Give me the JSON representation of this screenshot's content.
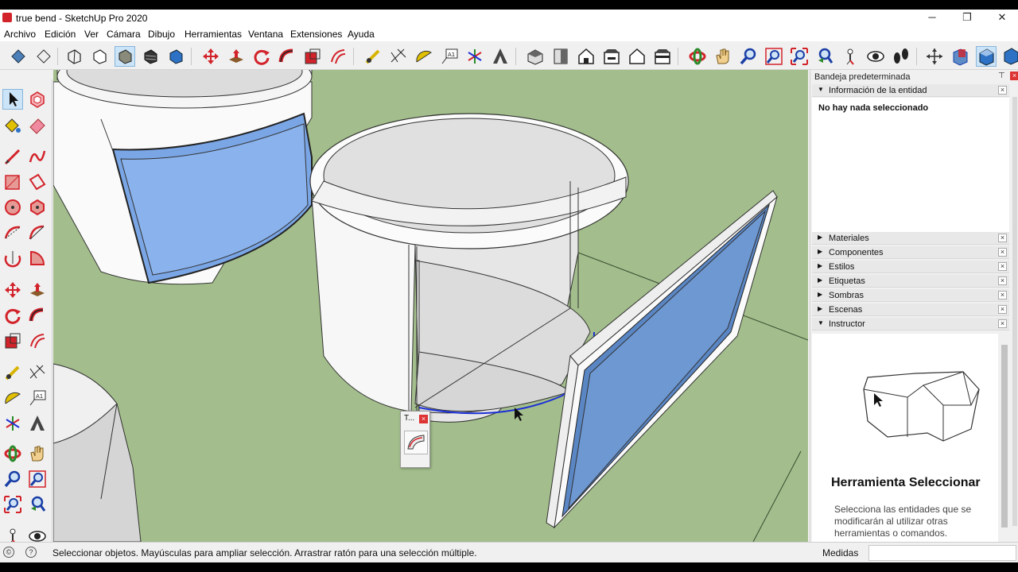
{
  "window": {
    "title": "true bend - SketchUp Pro 2020",
    "minimize": "─",
    "restore": "❐",
    "close": "✕"
  },
  "menu": [
    "Archivo",
    "Edición",
    "Ver",
    "Cámara",
    "Dibujo",
    "Herramientas",
    "Ventana",
    "Extensiones",
    "Ayuda"
  ],
  "toolbar": {
    "icons": [
      "xray-icon",
      "back-edges-icon",
      "wireframe-icon",
      "hidden-line-icon",
      "shaded-icon",
      "shaded-textures-icon",
      "monochrome-icon",
      "move-icon",
      "push-pull-icon",
      "rotate-icon",
      "follow-me-icon",
      "scale-icon",
      "offset-icon",
      "tape-measure-icon",
      "dimension-icon",
      "protractor-icon",
      "text-icon",
      "axes-icon",
      "3d-text-icon",
      "iso-view-icon",
      "top-view-icon",
      "front-view-icon",
      "right-view-icon",
      "back-view-icon",
      "left-view-icon",
      "orbit-icon",
      "pan-icon",
      "zoom-icon",
      "zoom-window-icon",
      "zoom-extents-icon",
      "previous-view-icon",
      "position-camera-icon",
      "look-around-icon",
      "walk-icon",
      "section-plane-icon",
      "display-section-planes-icon",
      "display-section-cuts-icon",
      "section-fill-icon"
    ],
    "active": "shaded-icon"
  },
  "palette": {
    "tools": [
      "select-icon",
      "make-component-icon",
      "paint-bucket-icon",
      "eraser-icon",
      "line-icon",
      "freehand-icon",
      "rectangle-icon",
      "rotated-rectangle-icon",
      "circle-icon",
      "polygon-icon",
      "arc-icon",
      "two-point-arc-icon",
      "three-point-arc-icon",
      "pie-icon",
      "move-icon",
      "push-pull-icon",
      "rotate-icon",
      "follow-me-icon",
      "scale-icon",
      "offset-icon",
      "tape-measure-icon",
      "dimension-icon",
      "protractor-icon",
      "text-icon",
      "axes-icon",
      "3d-text-icon",
      "orbit-icon",
      "pan-icon",
      "zoom-icon",
      "zoom-window-icon",
      "zoom-extents-icon",
      "previous-view-icon",
      "position-camera-icon",
      "look-around-icon"
    ],
    "active": "select-icon"
  },
  "tray": {
    "title": "Bandeja predeterminada",
    "pin": "⊤",
    "close": "×",
    "entity_info": {
      "label": "Información de la entidad",
      "message": "No hay nada seleccionado"
    },
    "panels": [
      "Materiales",
      "Componentes",
      "Estilos",
      "Etiquetas",
      "Sombras",
      "Escenas"
    ],
    "instructor": {
      "label": "Instructor",
      "tool_title": "Herramienta Seleccionar",
      "description": "Selecciona las entidades que se modificarán al utilizar otras herramientas o comandos."
    }
  },
  "mini_toolbar": {
    "title": "T...",
    "close": "×",
    "tool_icon": "true-bend-icon"
  },
  "status": {
    "text": "Seleccionar objetos. Mayúsculas para ampliar selección. Arrastrar ratón para una selección múltiple.",
    "measurements_label": "Medidas",
    "measurements_value": ""
  },
  "colors": {
    "ground": "#a3be8c",
    "glass": "#7aa6e6",
    "accent_red": "#d2232a",
    "selection_blue": "#1a2fd6"
  }
}
